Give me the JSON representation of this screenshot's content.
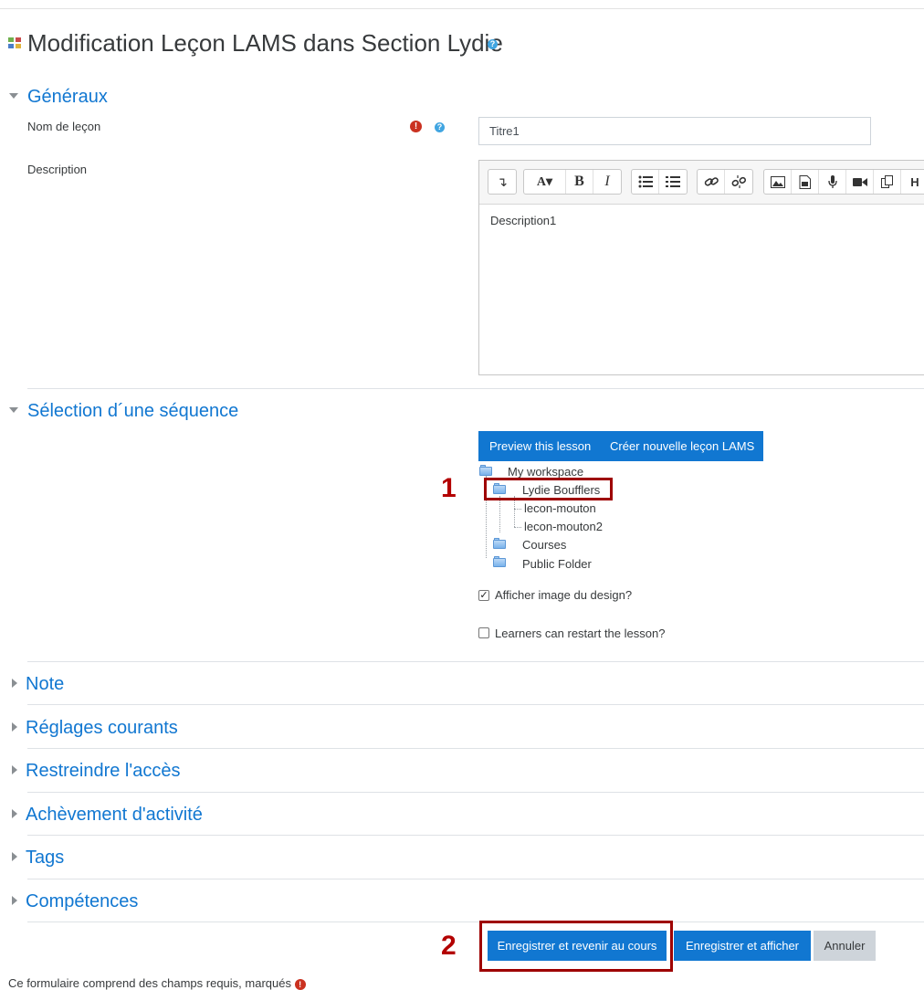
{
  "page": {
    "title": "Modification Leçon LAMS dans Section Lydie",
    "help_glyph": "?"
  },
  "sections": {
    "generaux": "Généraux",
    "selection": "Sélection d´une séquence",
    "note": "Note",
    "reglages": "Réglages courants",
    "restreindre": "Restreindre l'accès",
    "achevement": "Achèvement d'activité",
    "tags": "Tags",
    "competences": "Compétences"
  },
  "form": {
    "name_label": "Nom de leçon",
    "name_value": "Titre1",
    "required_glyph": "!",
    "description_label": "Description",
    "description_value": "Description1"
  },
  "editor_toolbar": {
    "groups": [
      [
        "expand-icon"
      ],
      [
        "font-icon",
        "bold-icon",
        "italic-icon"
      ],
      [
        "bullet-list-icon",
        "numbered-list-icon"
      ],
      [
        "link-icon",
        "unlink-icon"
      ],
      [
        "image-icon",
        "media-icon",
        "microphone-icon",
        "video-icon",
        "copy-icon",
        "h5p-icon"
      ]
    ]
  },
  "lams": {
    "preview_label": "Preview this lesson",
    "create_label": "Créer nouvelle leçon LAMS",
    "tree": {
      "root": "My workspace",
      "user_folder": "Lydie Boufflers",
      "lesson1": "lecon-mouton",
      "lesson2": "lecon-mouton2",
      "courses": "Courses",
      "public": "Public Folder"
    },
    "show_design_label": "Afficher image du design?",
    "show_design_checked": true,
    "restart_label": "Learners can restart the lesson?",
    "restart_checked": false
  },
  "annotations": {
    "step1": "1",
    "step2": "2",
    "highlight_color": "#9e0000"
  },
  "buttons": {
    "save_return": "Enregistrer et revenir au cours",
    "save_display": "Enregistrer et afficher",
    "cancel": "Annuler"
  },
  "footer": {
    "required_note": "Ce formulaire comprend des champs requis, marqués"
  },
  "colors": {
    "primary": "#1177d1",
    "required": "#ca3120",
    "help": "#41a5e1"
  }
}
